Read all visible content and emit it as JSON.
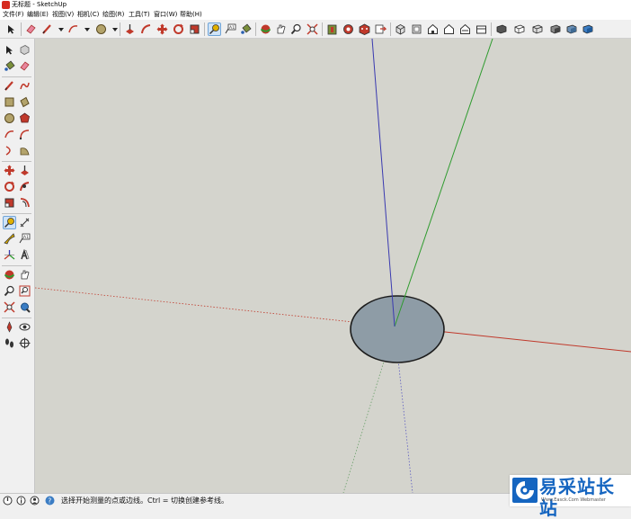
{
  "window": {
    "title": "无标题 - SketchUp"
  },
  "menu": [
    {
      "id": "file",
      "label": "文件(F)"
    },
    {
      "id": "edit",
      "label": "编辑(E)"
    },
    {
      "id": "view",
      "label": "视图(V)"
    },
    {
      "id": "camera",
      "label": "相机(C)"
    },
    {
      "id": "draw",
      "label": "绘图(R)"
    },
    {
      "id": "tools",
      "label": "工具(T)"
    },
    {
      "id": "window",
      "label": "窗口(W)"
    },
    {
      "id": "help",
      "label": "帮助(H)"
    }
  ],
  "status": {
    "text": "选择开始测量的点或边线。Ctrl = 切换创建参考线。"
  },
  "watermark": {
    "text": "易采站长站",
    "subtext": "Www.Easck.Com Webmaster"
  },
  "colors": {
    "viewport_bg": "#d4d4cd",
    "axis_red": "#c0392b",
    "axis_green": "#2e9b2e",
    "axis_blue": "#3a3ab0",
    "circle_fill": "#8e9ca6",
    "active_tool": "#cfe3f7",
    "watermark_blue": "#1565c0"
  }
}
